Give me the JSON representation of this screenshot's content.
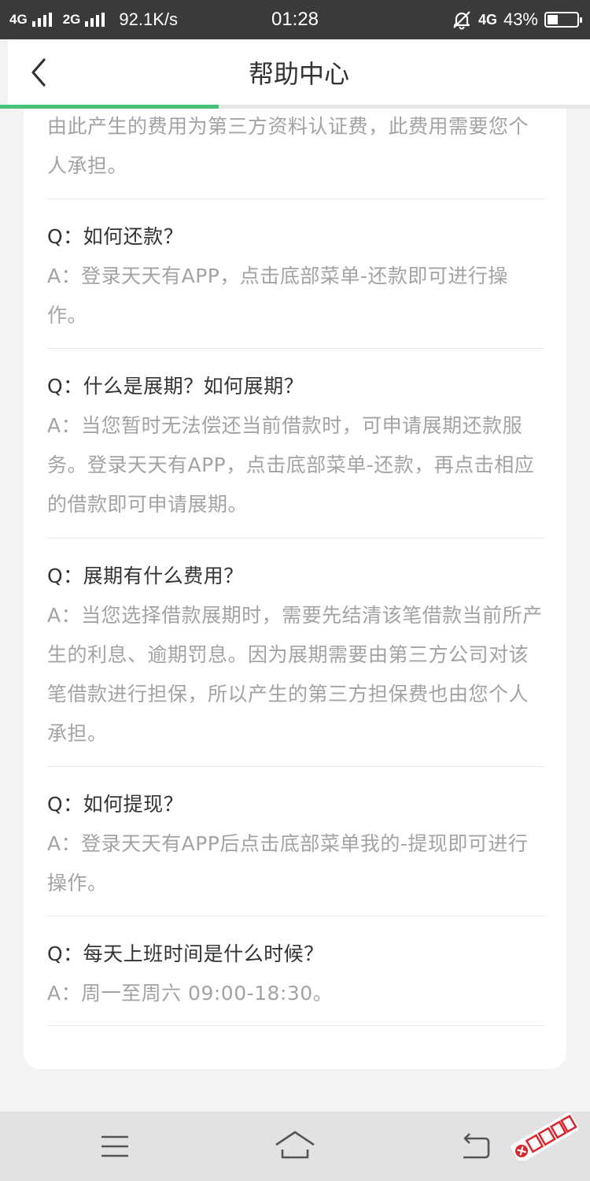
{
  "status_bar": {
    "net1": "4G",
    "net2": "2G",
    "speed": "92.1K/s",
    "time": "01:28",
    "net3": "4G",
    "battery_text": "43%",
    "battery_level": 0.43
  },
  "nav": {
    "title": "帮助中心",
    "load_progress": 0.37
  },
  "accent_color": "#48c278",
  "faq": {
    "partial_answer": "由此产生的费用为第三方资料认证费，此费用需要您个人承担。",
    "items": [
      {
        "q": "Q：如何还款？",
        "a": "A：登录天天有APP，点击底部菜单-还款即可进行操作。"
      },
      {
        "q": "Q：什么是展期？如何展期？",
        "a": "A：当您暂时无法偿还当前借款时，可申请展期还款服务。登录天天有APP，点击底部菜单-还款，再点击相应的借款即可申请展期。"
      },
      {
        "q": "Q：展期有什么费用？",
        "a": "A：当您选择借款展期时，需要先结清该笔借款当前所产生的利息、逾期罚息。因为展期需要由第三方公司对该笔借款进行担保，所以产生的第三方担保费也由您个人承担。"
      },
      {
        "q": "Q：如何提现？",
        "a": "A：登录天天有APP后点击底部菜单我的-提现即可进行操作。"
      },
      {
        "q": "Q：每天上班时间是什么时候？",
        "a": "A：周一至周六 09:00-18:30。"
      }
    ]
  },
  "watermark": "卡农社区",
  "icons": {
    "back": "chevron-left-icon",
    "menu": "menu-icon",
    "home": "home-icon",
    "back_nav": "return-icon",
    "mute": "bell-off-icon"
  }
}
